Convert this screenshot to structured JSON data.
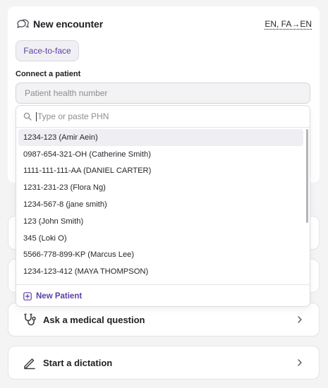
{
  "header": {
    "title": "New encounter",
    "lang_toggle": "EN, FA→EN"
  },
  "tabs": {
    "face_to_face": "Face-to-face"
  },
  "patient": {
    "label": "Connect a patient",
    "placeholder": "Patient health number"
  },
  "dropdown": {
    "search_placeholder": "Type or paste PHN",
    "items": [
      "1234-123 (Amir Aein)",
      "0987-654-321-OH (Catherine Smith)",
      "1111-111-111-AA (DANIEL CARTER)",
      "1231-231-23 (Flora Ng)",
      "1234-567-8 (jane smith)",
      "123 (John Smith)",
      "345 (Loki O)",
      "5566-778-899-KP (Marcus Lee)",
      "1234-123-412 (MAYA THOMPSON)"
    ],
    "new_patient": "New Patient"
  },
  "actions": {
    "ask": "Ask a medical question",
    "dictation": "Start a dictation"
  },
  "colors": {
    "accent": "#5a3fa8",
    "background": "#f4f4f5"
  }
}
